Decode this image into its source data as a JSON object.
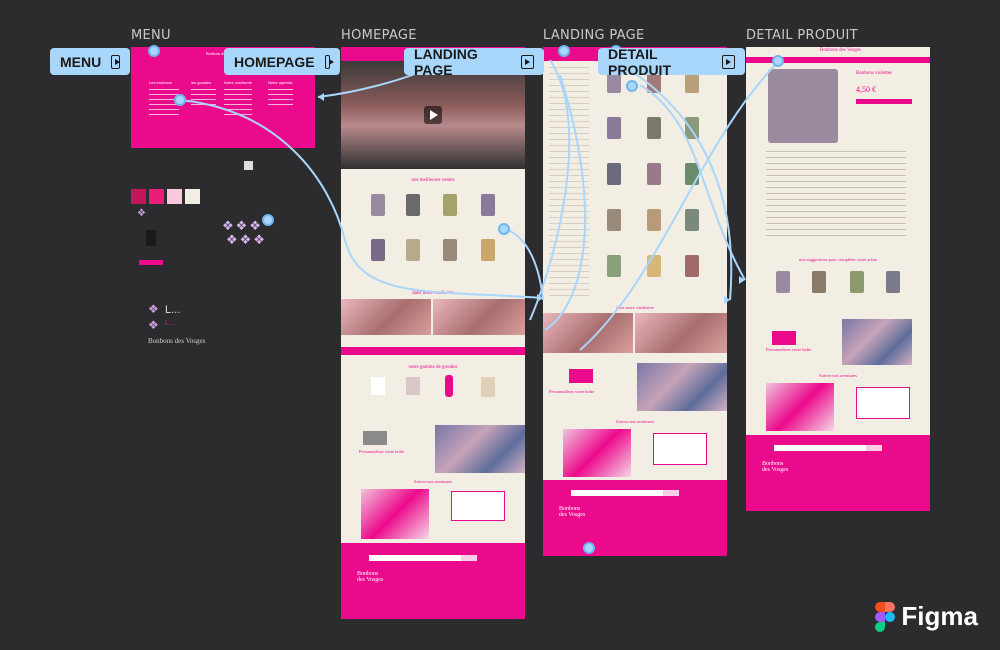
{
  "frames": {
    "menu": {
      "title": "MENU"
    },
    "homepage": {
      "title": "HOMEPAGE"
    },
    "landing": {
      "title": "LANDING PAGE"
    },
    "detail": {
      "title": "DETAIL PRODUIT"
    }
  },
  "flow_chips": {
    "menu": "MENU",
    "homepage": "HOMEPAGE",
    "landing": "LANDING PAGE",
    "detail": "DETAIL PRODUIT"
  },
  "menu_content": {
    "brand": "Bonbons des Vosges",
    "columns": [
      "Les bonbons",
      "les goodies",
      "Notre confiserie",
      "Notre agenda"
    ]
  },
  "homepage_content": {
    "section1": "nos meilleures ventes",
    "section2": "dans notre confiserie",
    "section3": "notre gamme de goodies",
    "section4": "Personnalisez votre boîte",
    "section5": "Suivez nos aventures",
    "footer_logo": "Bonbons des Vosges"
  },
  "landing_content": {
    "section1": "dans notre confiserie",
    "section2": "Personnalisez votre boîte",
    "section3": "Suivez nos aventures",
    "footer_logo": "Bonbons des Vosges"
  },
  "detail_content": {
    "product_name": "Bonbons violettes",
    "price": "4,50 €",
    "suggest": "nos suggestions pour compléter votre achat",
    "section2": "Personnalisez votre boîte",
    "section3": "Suivez nos aventures",
    "footer_logo": "Bonbons des Vosges"
  },
  "assets": {
    "logo_text": "Bonbons des Vosges",
    "swatches": [
      "#c2185b",
      "#e91e78",
      "#f8c8dc",
      "#f3eee4"
    ]
  },
  "app": {
    "name": "Figma"
  },
  "colors": {
    "brand_pink": "#ec0a8c",
    "bg": "#2c2c2f",
    "flow": "#a9d6fb"
  }
}
